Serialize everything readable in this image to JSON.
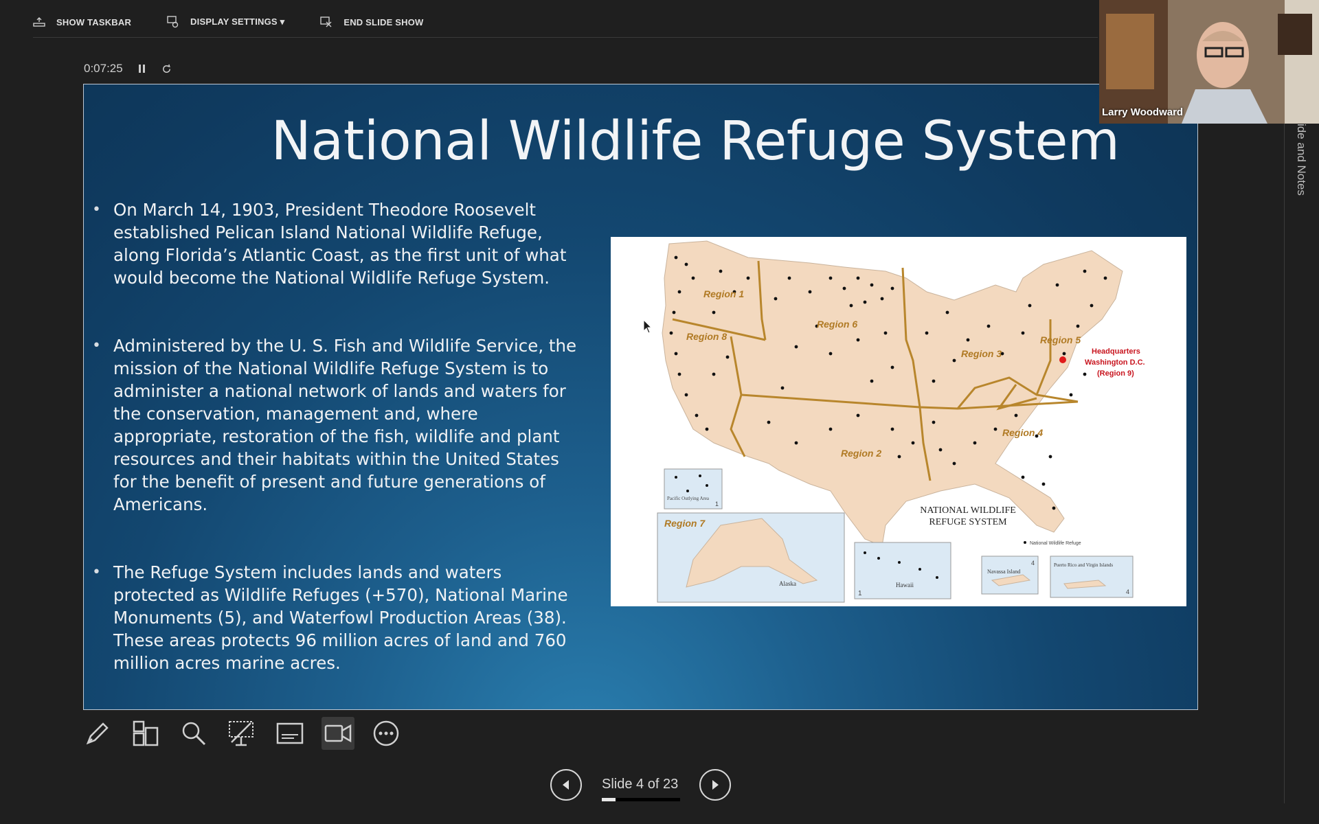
{
  "toolbar": {
    "show_taskbar": "SHOW TASKBAR",
    "display_settings": "DISPLAY SETTINGS ▾",
    "end_slide_show": "END SLIDE SHOW"
  },
  "timer": {
    "elapsed": "0:07:25",
    "pause_icon": "pause-icon",
    "restart_icon": "restart-icon"
  },
  "slide": {
    "title": "National Wildlife Refuge System",
    "bullets": [
      "On March 14, 1903, President Theodore Roosevelt established Pelican Island National Wildlife Refuge, along Florida’s Atlantic Coast, as the first unit of what would become the National Wildlife Refuge System.",
      "Administered by the U. S. Fish and Wildlife Service, the mission of the National Wildlife Refuge System is to administer a national network of lands and waters for the conservation, management and, where appropriate, restoration of the fish, wildlife and plant resources and their habitats within the United States for the benefit of present and future generations of Americans.",
      "The Refuge System includes lands and waters protected as Wildlife Refuges (+570), National Marine Monuments (5), and Waterfowl Production Areas (38).  These areas protects 96 million acres of land and 760 million acres marine acres."
    ],
    "map": {
      "title_line1": "NATIONAL WILDLIFE",
      "title_line2": "REFUGE SYSTEM",
      "regions": [
        "Region 1",
        "Region 8",
        "Region 6",
        "Region 3",
        "Region 5",
        "Region 4",
        "Region 2",
        "Region 7"
      ],
      "hq_line1": "Headquarters",
      "hq_line2": "Washington D.C.",
      "hq_line3": "(Region 9)",
      "legend": "National Wildlife Refuge",
      "inset_pacific": "Pacific Outlying Area",
      "inset_pacific_num": "1",
      "inset_alaska": "Alaska",
      "inset_hawaii": "Hawaii",
      "inset_hawaii_num": "1",
      "inset_navassa": "Navassa Island",
      "inset_navassa_num": "4",
      "inset_pr": "Puerto Rico and Virgin Islands",
      "inset_pr_num": "4",
      "colors": {
        "land": "#f3d9bf",
        "boundary": "#b8862c",
        "water": "#dbe9f4",
        "hq": "#e01a1a"
      }
    }
  },
  "side_panel": {
    "label": "ide and Notes"
  },
  "webcam": {
    "name": "Larry Woodward"
  },
  "tools": [
    "pen-icon",
    "slides-grid-icon",
    "zoom-icon",
    "laser-pointer-icon",
    "subtitles-icon",
    "camera-icon",
    "more-options-icon"
  ],
  "navigation": {
    "slide_counter": "Slide 4 of 23",
    "progress": 0.174
  }
}
